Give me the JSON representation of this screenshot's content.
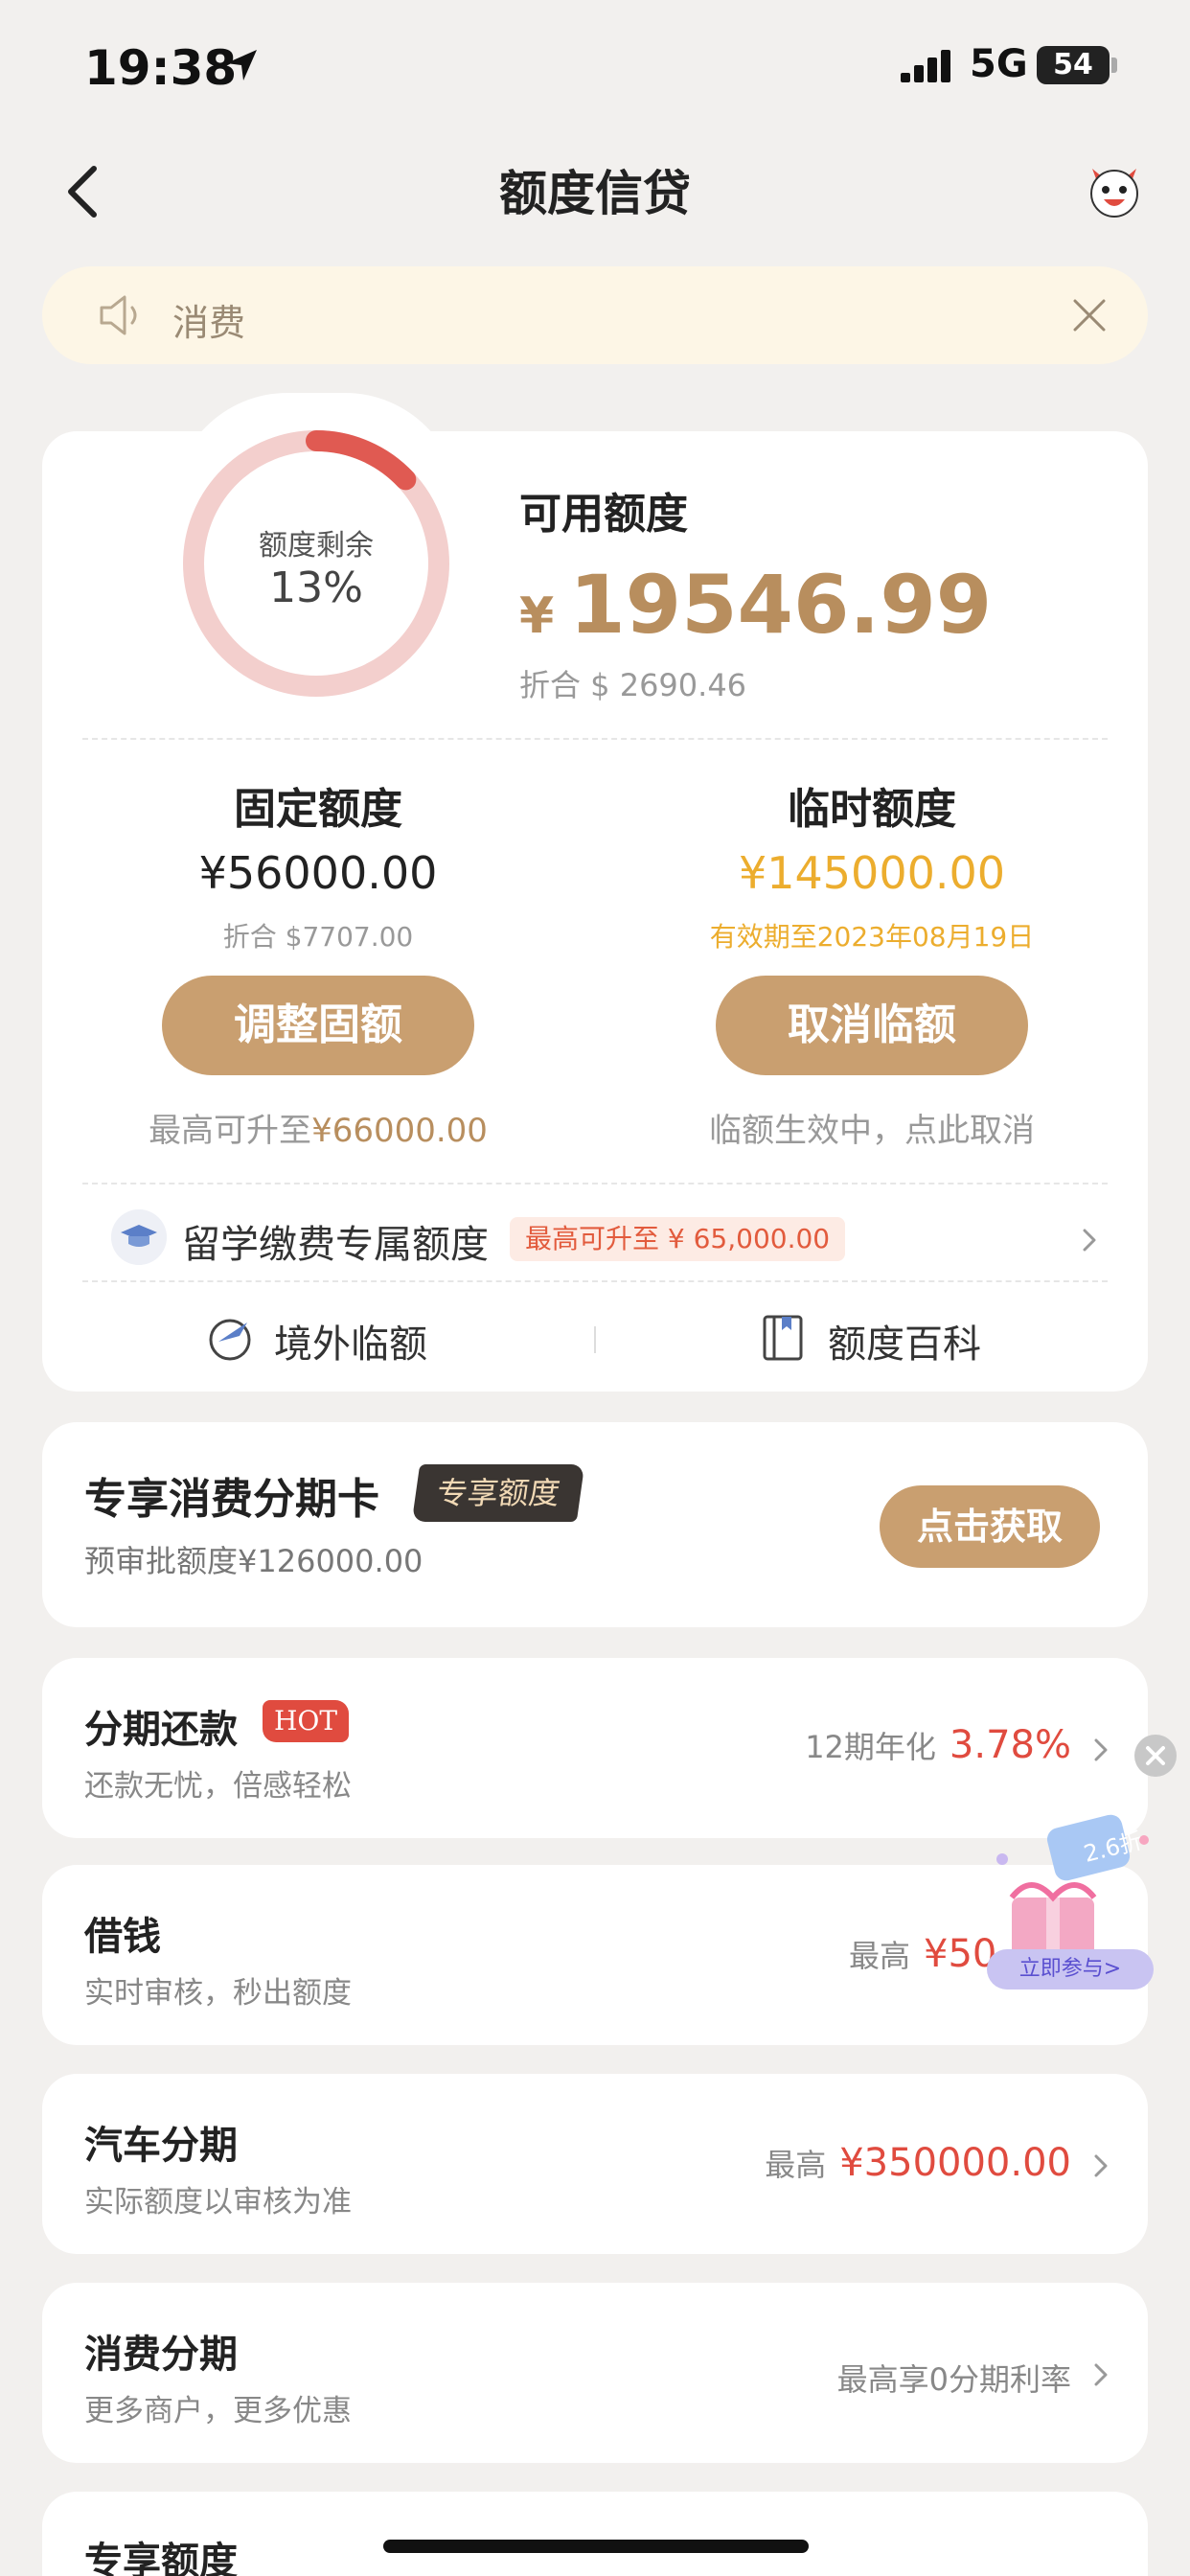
{
  "status_bar": {
    "time": "19:38",
    "network": "5G",
    "battery": "54"
  },
  "nav": {
    "title": "额度信贷"
  },
  "notice": {
    "text": "消费"
  },
  "credit": {
    "ring_label": "额度剩余",
    "ring_percent_text": "13%",
    "ring_fraction": 0.13,
    "available_label": "可用额度",
    "currency_symbol": "¥",
    "available_amount": "19546.99",
    "available_converted": "折合 $ 2690.46",
    "fixed": {
      "title": "固定额度",
      "amount": "¥56000.00",
      "converted": "折合 $7707.00",
      "button": "调整固额",
      "note_prefix": "最高可升至",
      "note_value": "¥66000.00"
    },
    "temp": {
      "title": "临时额度",
      "amount": "¥145000.00",
      "expiry": "有效期至2023年08月19日",
      "button": "取消临额",
      "note": "临额生效中，点此取消"
    },
    "study": {
      "label": "留学缴费专属额度",
      "badge": "最高可升至 ¥ 65,000.00"
    },
    "tools": [
      {
        "label": "境外临额",
        "icon": "globe-plane-icon"
      },
      {
        "label": "额度百科",
        "icon": "book-icon"
      }
    ]
  },
  "installment_card": {
    "title": "专享消费分期卡",
    "badge": "专享额度",
    "subtitle": "预审批额度¥126000.00",
    "button": "点击获取"
  },
  "products": [
    {
      "title": "分期还款",
      "badge": "HOT",
      "subtitle": "还款无忧，倍感轻松",
      "prefix": "12期年化",
      "value": "3.78%"
    },
    {
      "title": "借钱",
      "subtitle": "实时审核，秒出额度",
      "prefix": "最高",
      "value": "¥50"
    },
    {
      "title": "汽车分期",
      "subtitle": "实际额度以审核为准",
      "prefix": "最高",
      "value": "¥350000.00"
    },
    {
      "title": "消费分期",
      "subtitle": "更多商户，更多优惠",
      "prefix": "最高享0分期利率",
      "value": ""
    },
    {
      "title": "专享额度",
      "subtitle": "",
      "prefix": "",
      "value": ""
    }
  ],
  "promo": {
    "discount": "2.6折",
    "cta": "立即参与>"
  },
  "colors": {
    "accent": "#c99f70",
    "gold_text": "#b88e5e",
    "temp_amount": "#ecad2e",
    "red": "#e04b3f",
    "ring_track": "#f3cfcd",
    "ring_fill": "#e05a52"
  }
}
